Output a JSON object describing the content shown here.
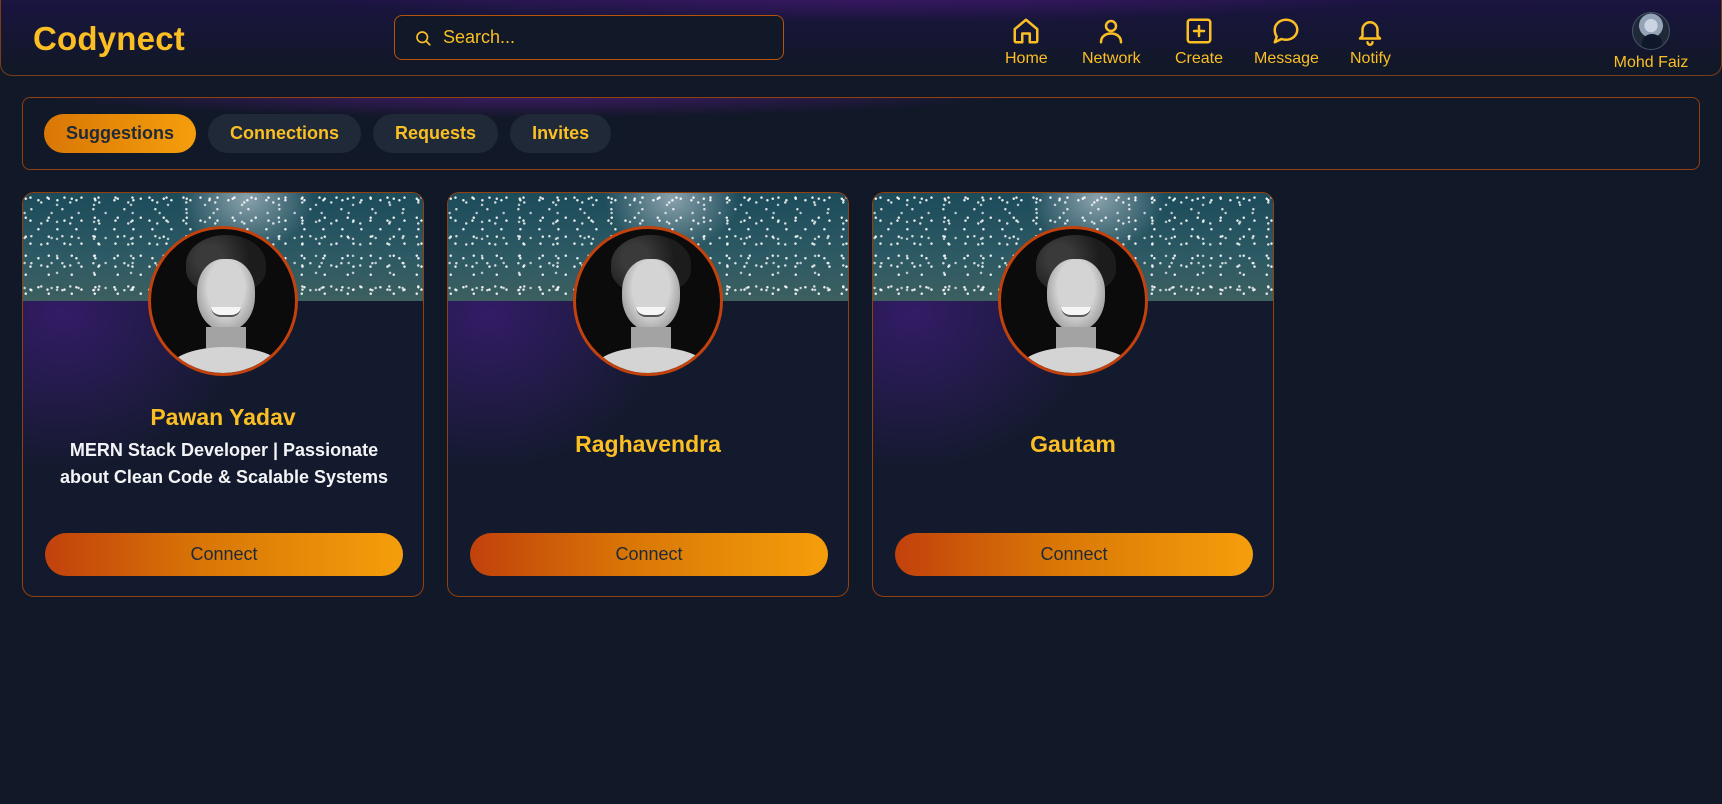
{
  "app": {
    "logo": "Codynect"
  },
  "search": {
    "placeholder": "Search..."
  },
  "nav": {
    "items": [
      {
        "label": "Home",
        "icon": "home-icon"
      },
      {
        "label": "Network",
        "icon": "user-icon"
      },
      {
        "label": "Create",
        "icon": "plus-square-icon"
      },
      {
        "label": "Message",
        "icon": "message-icon"
      },
      {
        "label": "Notify",
        "icon": "bell-icon"
      }
    ]
  },
  "profile": {
    "name": "Mohd Faiz"
  },
  "tabs": [
    {
      "label": "Suggestions",
      "active": true
    },
    {
      "label": "Connections",
      "active": false
    },
    {
      "label": "Requests",
      "active": false
    },
    {
      "label": "Invites",
      "active": false
    }
  ],
  "cards": [
    {
      "name": "Pawan Yadav",
      "bio": "MERN Stack Developer | Passionate about Clean Code & Scalable Systems",
      "button": "Connect"
    },
    {
      "name": "Raghavendra",
      "bio": "",
      "button": "Connect"
    },
    {
      "name": "Gautam",
      "bio": "",
      "button": "Connect"
    }
  ],
  "colors": {
    "accent": "#fbbf24",
    "accent_dark": "#d97706",
    "background": "#111827",
    "border": "#92400e"
  }
}
